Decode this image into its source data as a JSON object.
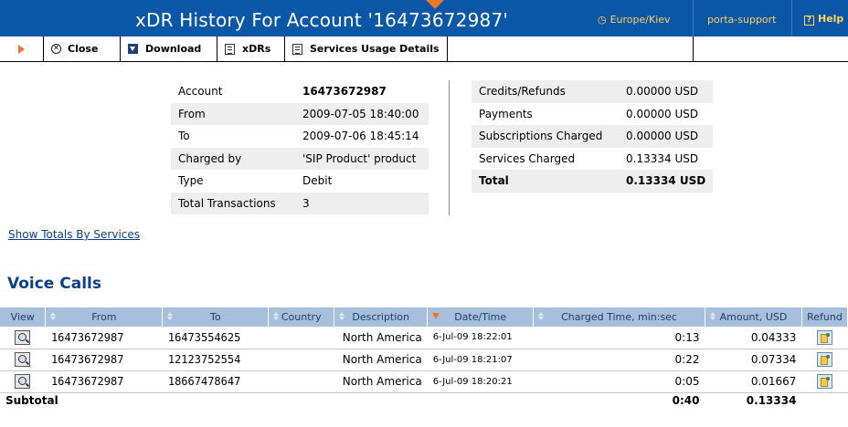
{
  "header": {
    "title": "xDR History For Account '16473672987'",
    "timezone": "Europe/Kiev",
    "user": "porta-support",
    "help_label": "Help",
    "colors": {
      "bar": "#0a57a8",
      "link": "#ffd25a",
      "accent": "#e8782a"
    }
  },
  "toolbar": {
    "close_label": "Close",
    "download_label": "Download",
    "xdrs_label": "xDRs",
    "services_label": "Services Usage Details"
  },
  "info": {
    "rows": [
      {
        "label": "Account",
        "value": "16473672987"
      },
      {
        "label": "From",
        "value": "2009-07-05 18:40:00"
      },
      {
        "label": "To",
        "value": "2009-07-06 18:45:14"
      },
      {
        "label": "Charged by",
        "value": "'SIP Product' product"
      },
      {
        "label": "Type",
        "value": "Debit"
      },
      {
        "label": "Total Transactions",
        "value": "3"
      }
    ]
  },
  "totals": {
    "rows": [
      {
        "label": "Credits/Refunds",
        "value": "0.00000 USD"
      },
      {
        "label": "Payments",
        "value": "0.00000 USD"
      },
      {
        "label": "Subscriptions Charged",
        "value": "0.00000 USD"
      },
      {
        "label": "Services Charged",
        "value": "0.13334 USD"
      },
      {
        "label": "Total",
        "value": "0.13334 USD"
      }
    ]
  },
  "links": {
    "show_totals": "Show Totals By Services"
  },
  "section": {
    "title": "Voice Calls"
  },
  "calls": {
    "headers": {
      "view": "View",
      "from": "From",
      "to": "To",
      "country": "Country",
      "description": "Description",
      "datetime": "Date/Time",
      "charged": "Charged Time, min:sec",
      "amount": "Amount, USD",
      "refund": "Refund"
    },
    "rows": [
      {
        "from": "16473672987",
        "to": "16473554625",
        "country": "",
        "description": "North America",
        "datetime": "6-Jul-09 18:22:01",
        "charged": "0:13",
        "amount": "0.04333"
      },
      {
        "from": "16473672987",
        "to": "12123752554",
        "country": "",
        "description": "North America",
        "datetime": "6-Jul-09 18:21:07",
        "charged": "0:22",
        "amount": "0.07334"
      },
      {
        "from": "16473672987",
        "to": "18667478647",
        "country": "",
        "description": "North America",
        "datetime": "6-Jul-09 18:20:21",
        "charged": "0:05",
        "amount": "0.01667"
      }
    ],
    "subtotal": {
      "label": "Subtotal",
      "charged": "0:40",
      "amount": "0.13334"
    }
  }
}
